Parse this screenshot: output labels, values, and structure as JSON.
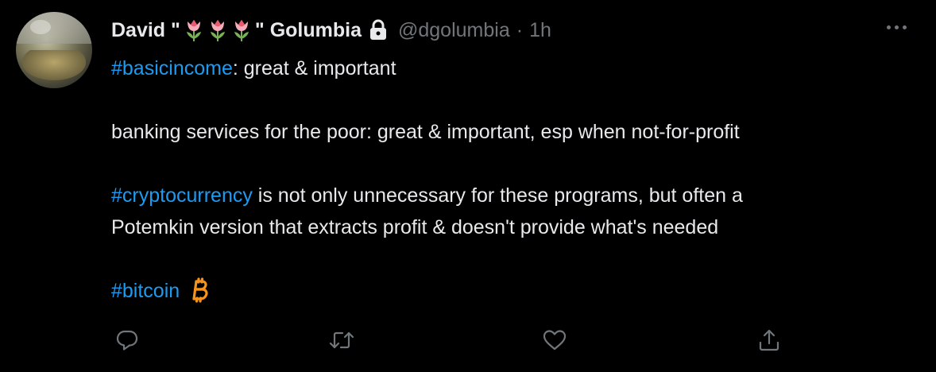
{
  "tweet": {
    "author_name_prefix": "David \"",
    "author_name_suffix": "\" Golumbia",
    "author_name_emoji": [
      "tulip",
      "tulip",
      "tulip"
    ],
    "handle": "@dgolumbia",
    "separator": "·",
    "time": "1h",
    "body": {
      "line1_tag": "#basicincome",
      "line1_rest": ": great & important",
      "line2": "banking services for the poor: great & important, esp when not-for-profit",
      "line3_tag": "#cryptocurrency",
      "line3_rest": " is not only unnecessary for these programs, but often a",
      "line4": "Potemkin version that extracts profit & doesn't provide what's needed",
      "line5_tag": "#bitcoin"
    },
    "icons": [
      "lock-icon",
      "more-icon",
      "bitcoin-icon",
      "reply-icon",
      "retweet-icon",
      "like-icon",
      "share-icon"
    ],
    "colors": {
      "background": "#000000",
      "text": "#e7e9ea",
      "secondary": "#71767b",
      "link": "#1d9bf0",
      "bitcoin": "#f7931a"
    }
  }
}
